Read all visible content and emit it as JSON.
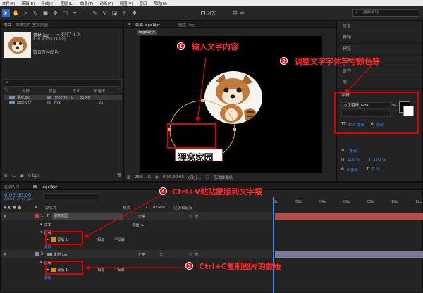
{
  "menu": [
    "文件(F)",
    "编辑(E)",
    "合成(C)",
    "图层(L)",
    "效果(T)",
    "动画(A)",
    "视图(V)",
    "窗口",
    "帮助(H)"
  ],
  "toolbar": {
    "align_label": "对齐",
    "search_placeholder": "搜索帮助"
  },
  "project": {
    "tabs": [
      "项目",
      "效果控件 狸窝家园"
    ],
    "file_name": "素材.jpg",
    "usage": "▾ 使用了 1 次",
    "dims": "640 x 640 (1.00)",
    "desc": "数百万种颜色",
    "columns": [
      "名称",
      "类型",
      "大小",
      "帧速率"
    ],
    "items": [
      {
        "name": "素材.jpg",
        "type": "Importe...G",
        "size": "36 KB",
        "fps": ""
      },
      {
        "name": "logo设计",
        "type": "合成",
        "size": "",
        "fps": "25"
      }
    ],
    "bpc": "8 bpc"
  },
  "composition": {
    "tab": "合成 logo设计",
    "layer_tab": "图层（无）",
    "comp_label": "logo设计",
    "text": "狸窝家园",
    "zoom": "25%",
    "timecode": "0:00:00:00",
    "quality": "(四分...",
    "camera": "活动摄像机"
  },
  "right_panel": {
    "items": [
      "信息",
      "音频",
      "预览",
      "效果和预设",
      "对齐",
      "库"
    ],
    "char_title": "字符",
    "font": "方正粗倩_GBK",
    "size": "100 像素",
    "auto": "自动",
    "units": "- 像素",
    "pct1": "100 %",
    "pct2": "100 %",
    "px0": "0 像素",
    "pct0": "0 %"
  },
  "timeline": {
    "tabs": [
      "渲染队列",
      "logo设计"
    ],
    "timecode": "0:00:00:00",
    "fps_info": "00000 (25.00 fps)",
    "col_headers": [
      "#",
      "源名称",
      "模式",
      "T",
      "TrkMat",
      "父级和链接"
    ],
    "ruler": [
      "0s",
      "02s",
      "04s",
      "06s",
      "08s",
      "10s",
      "12s"
    ],
    "layers": [
      {
        "num": "1",
        "icon": "T",
        "name": "狸窝家园",
        "mode": "正常",
        "parent": "无"
      },
      {
        "num": "2",
        "icon": "",
        "name": "素材.jpg",
        "mode": "正常",
        "parent": "无"
      }
    ],
    "text_label": "文本",
    "mask_label": "蒙版",
    "mask1": "蒙版 1",
    "mask2": "蒙版 1",
    "add": "相加",
    "invert": "反转",
    "animate": "动画: ▶",
    "mask_prop": "蒙版",
    "none_label": "无"
  },
  "annotations": {
    "c1": "输入文字内容",
    "c2": "调整文字字体字号颜色等",
    "c3": "Ctrl+C复制图片的蒙版",
    "c4": "Ctrl+V粘贴蒙版到文字层",
    "n1": "1",
    "n2": "2",
    "n3": "3",
    "n4": "4"
  },
  "colors": {
    "accent": "#2c6bd3",
    "annotation": "#e00000",
    "mask": "#e68a00"
  }
}
